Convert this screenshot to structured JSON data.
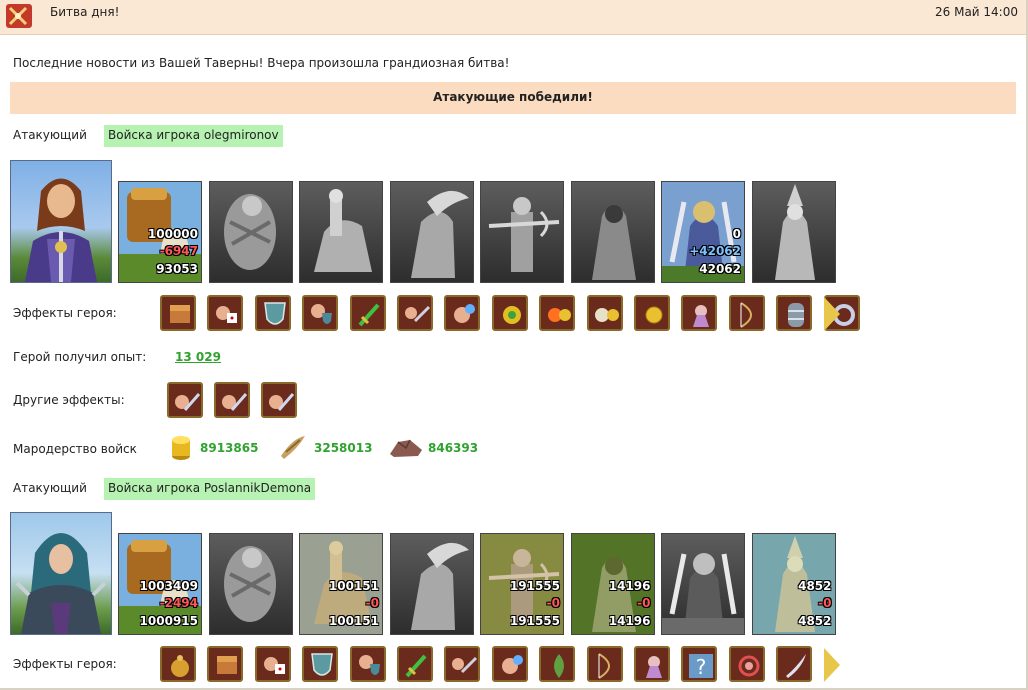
{
  "window": {
    "title": "Битва дня!",
    "date": "26 Май 14:00"
  },
  "news": "Последние новости из Вашей Таверны! Вчера произошла грандиозная битва!",
  "result": "Атакующие победили!",
  "armies": [
    {
      "role_label": "Атакующий",
      "army_name": "Войска игрока olegmironov",
      "hero": "female-knight-portrait",
      "units": [
        {
          "name": "peasant-cart",
          "alive": true,
          "counts": [
            "100000",
            "-6947",
            "93053"
          ],
          "gain": false
        },
        {
          "name": "stone-golem",
          "alive": false,
          "counts": []
        },
        {
          "name": "cavalry",
          "alive": false,
          "counts": []
        },
        {
          "name": "pegasus",
          "alive": false,
          "counts": []
        },
        {
          "name": "crossbowman",
          "alive": false,
          "counts": []
        },
        {
          "name": "monk",
          "alive": false,
          "counts": []
        },
        {
          "name": "swordmaster",
          "alive": true,
          "counts": [
            "0",
            "+42062",
            "42062"
          ],
          "gain": true
        },
        {
          "name": "wizard",
          "alive": false,
          "counts": []
        }
      ],
      "hero_effects_label": "Эффекты героя:",
      "hero_effects": [
        "chest-icon",
        "fist-dice-icon",
        "shield-icon",
        "hand-shield-icon",
        "sword-icon",
        "hand-sword-icon",
        "magic-hand-icon",
        "gold-orb-icon",
        "fire-coin-icon",
        "skull-coin-icon",
        "coin-icon",
        "priest-icon",
        "bow-icon",
        "barrel-icon",
        "ring-icon"
      ],
      "experience_label": "Герой получил опыт:",
      "experience": "13 029",
      "other_effects_label": "Другие эффекты:",
      "other_effects": [
        "fist-sword-icon",
        "fist-sword-icon",
        "fist-sword-icon"
      ],
      "loot_label": "Мародерство войск",
      "loot": [
        {
          "icon": "gold-icon",
          "value": "8913865"
        },
        {
          "icon": "wood-icon",
          "value": "3258013"
        },
        {
          "icon": "ore-icon",
          "value": "846393"
        }
      ]
    },
    {
      "role_label": "Атакующий",
      "army_name": "Войска игрока PoslannikDemona",
      "hero": "hooded-elf-portrait",
      "units": [
        {
          "name": "peasant-cart",
          "alive": true,
          "counts": [
            "1003409",
            "-2494",
            "1000915"
          ],
          "gain": false
        },
        {
          "name": "stone-golem",
          "alive": false,
          "counts": []
        },
        {
          "name": "cavalry",
          "alive": true,
          "counts": [
            "100151",
            "-0",
            "100151"
          ],
          "gain": false
        },
        {
          "name": "pegasus",
          "alive": false,
          "counts": []
        },
        {
          "name": "crossbowman",
          "alive": true,
          "counts": [
            "191555",
            "-0",
            "191555"
          ],
          "gain": false
        },
        {
          "name": "monk",
          "alive": true,
          "counts": [
            "14196",
            "-0",
            "14196"
          ],
          "gain": false
        },
        {
          "name": "swordmaster",
          "alive": false,
          "counts": []
        },
        {
          "name": "wizard",
          "alive": true,
          "counts": [
            "4852",
            "-0",
            "4852"
          ],
          "gain": false
        }
      ],
      "hero_effects_label": "Эффекты героя:",
      "hero_effects": [
        "coin-bag-icon",
        "chest-icon",
        "fist-dice-icon",
        "shield-icon",
        "hand-shield-icon",
        "sword-icon",
        "hand-sword-icon",
        "magic-hand-icon",
        "herb-icon",
        "bow-icon",
        "priest-icon",
        "question-icon",
        "swirl-icon",
        "feather-icon"
      ]
    }
  ],
  "colors": {
    "army_tag": "#b6f2b2",
    "banner": "#fcdcc0",
    "titlebar": "#fbe8d4",
    "value_green": "#2fa22f"
  }
}
